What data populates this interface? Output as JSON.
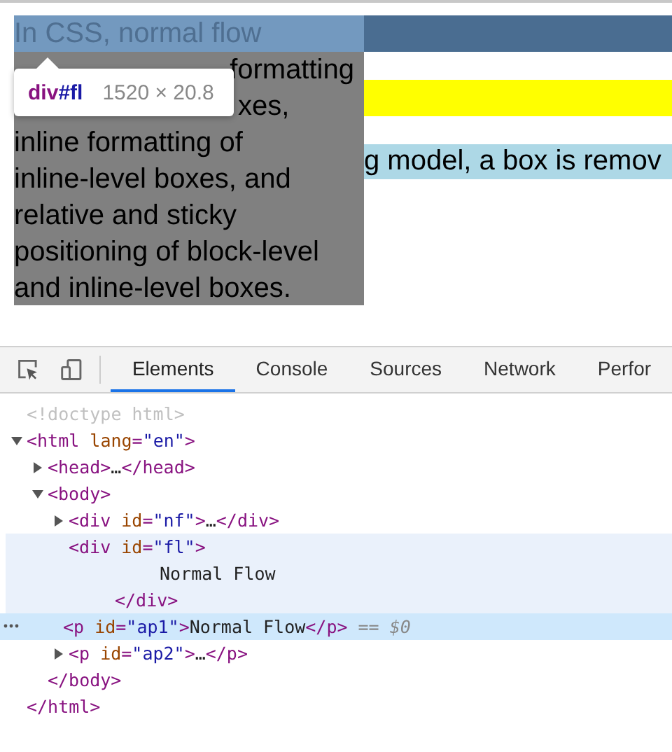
{
  "page": {
    "header_bar": {
      "highlighted_text": "In CSS, normal flow"
    },
    "floated_box": {
      "lines": [
        {
          "text": "formatting",
          "kind": "tail"
        },
        {
          "text": "xes,",
          "kind": "tail"
        },
        {
          "text": "inline formatting of",
          "kind": "full"
        },
        {
          "text": "inline-level boxes, and",
          "kind": "full"
        },
        {
          "text": "relative and sticky",
          "kind": "full"
        },
        {
          "text": "positioning of block-level",
          "kind": "full"
        },
        {
          "text": "and inline-level boxes.",
          "kind": "full"
        }
      ]
    },
    "paragraph": {
      "text": "g model, a box is remov"
    },
    "tooltip": {
      "tag": "div",
      "id": "#fl",
      "size": "1520 × 20.8"
    }
  },
  "devtools": {
    "tabs": [
      {
        "label": "Elements",
        "selected": true
      },
      {
        "label": "Console",
        "selected": false
      },
      {
        "label": "Sources",
        "selected": false
      },
      {
        "label": "Network",
        "selected": false
      },
      {
        "label": "Perfor",
        "selected": false
      }
    ],
    "tree": [
      {
        "selected": false,
        "hovered": false,
        "open": [
          {
            "kind": "doctype",
            "t": "<!doctype html>"
          }
        ]
      },
      {
        "selected": false,
        "hovered": false,
        "expanded": true,
        "open": [
          {
            "kind": "tag",
            "t": "<html"
          },
          {
            "kind": "attr",
            "t": " lang"
          },
          {
            "kind": "punct",
            "t": "="
          },
          {
            "kind": "value",
            "t": "\"en\""
          },
          {
            "kind": "tag",
            "t": ">"
          }
        ],
        "close": [
          {
            "kind": "tag",
            "t": "</html>"
          }
        ],
        "children": [
          {
            "selected": false,
            "hovered": false,
            "expanded": false,
            "open": [
              {
                "kind": "tag",
                "t": "<head>"
              },
              {
                "kind": "text",
                "t": "…"
              },
              {
                "kind": "tag",
                "t": "</head>"
              }
            ]
          },
          {
            "selected": false,
            "hovered": false,
            "expanded": true,
            "open": [
              {
                "kind": "tag",
                "t": "<body>"
              }
            ],
            "close": [
              {
                "kind": "tag",
                "t": "</body>"
              }
            ],
            "children": [
              {
                "selected": false,
                "hovered": false,
                "expanded": false,
                "open": [
                  {
                    "kind": "tag",
                    "t": "<div"
                  },
                  {
                    "kind": "attr",
                    "t": " id"
                  },
                  {
                    "kind": "punct",
                    "t": "="
                  },
                  {
                    "kind": "value",
                    "t": "\"nf\""
                  },
                  {
                    "kind": "tag",
                    "t": ">"
                  },
                  {
                    "kind": "text",
                    "t": "…"
                  },
                  {
                    "kind": "tag",
                    "t": "</div>"
                  }
                ]
              },
              {
                "selected": false,
                "hovered": true,
                "open": [
                  {
                    "kind": "tag",
                    "t": "<div"
                  },
                  {
                    "kind": "attr",
                    "t": " id"
                  },
                  {
                    "kind": "punct",
                    "t": "="
                  },
                  {
                    "kind": "value",
                    "t": "\"fl\""
                  },
                  {
                    "kind": "tag",
                    "t": ">"
                  }
                ],
                "close": [
                  {
                    "kind": "tag",
                    "t": "</div>"
                  }
                ],
                "children": [
                  {
                    "selected": false,
                    "hovered": true,
                    "kind": "text",
                    "open": [
                      {
                        "kind": "text",
                        "t": "Normal Flow"
                      }
                    ]
                  }
                ]
              },
              {
                "selected": true,
                "hovered": false,
                "open": [
                  {
                    "kind": "tag",
                    "t": "<p"
                  },
                  {
                    "kind": "attr",
                    "t": " id"
                  },
                  {
                    "kind": "punct",
                    "t": "="
                  },
                  {
                    "kind": "value",
                    "t": "\"ap1\""
                  },
                  {
                    "kind": "tag",
                    "t": ">"
                  },
                  {
                    "kind": "text",
                    "t": "Normal Flow"
                  },
                  {
                    "kind": "tag",
                    "t": "</p>"
                  },
                  {
                    "kind": "ref",
                    "t": " == $0"
                  }
                ]
              },
              {
                "selected": false,
                "hovered": false,
                "expanded": false,
                "open": [
                  {
                    "kind": "tag",
                    "t": "<p"
                  },
                  {
                    "kind": "attr",
                    "t": " id"
                  },
                  {
                    "kind": "punct",
                    "t": "="
                  },
                  {
                    "kind": "value",
                    "t": "\"ap2\""
                  },
                  {
                    "kind": "tag",
                    "t": ">"
                  },
                  {
                    "kind": "text",
                    "t": "…"
                  },
                  {
                    "kind": "tag",
                    "t": "</p>"
                  }
                ]
              }
            ]
          }
        ]
      }
    ]
  }
}
